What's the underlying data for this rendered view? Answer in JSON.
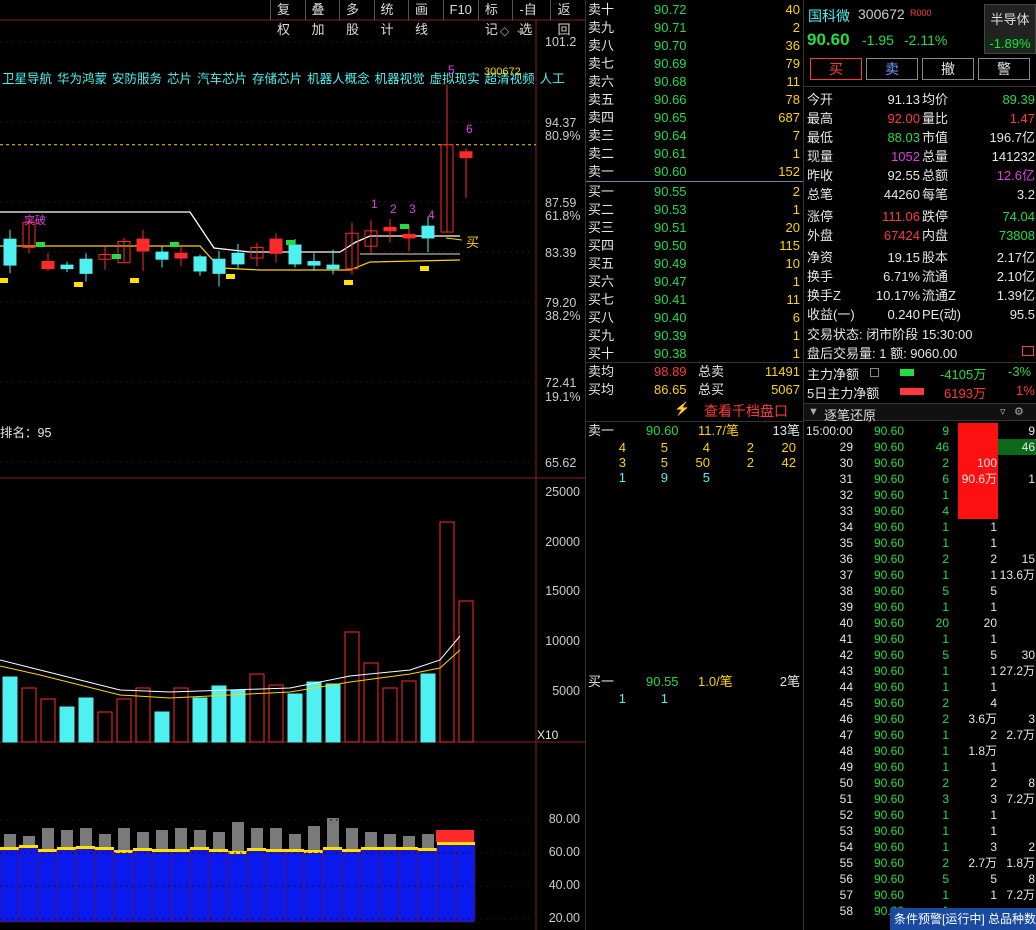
{
  "toolbar": [
    "复权",
    "叠加",
    "多股",
    "统计",
    "画线",
    "F10",
    "标记",
    "-自选",
    "返回"
  ],
  "concepts": [
    "卫星导航",
    "华为鸿蒙",
    "安防服务",
    "芯片",
    "汽车芯片",
    "存储芯片",
    "机器人概念",
    "机器视觉",
    "虚拟现实",
    "超清视频",
    "人工"
  ],
  "chart": {
    "code_label": "300672",
    "rank_label": "排名：95",
    "buy_label": "买",
    "cover_label": "突破",
    "marks": [
      "1",
      "2",
      "3",
      "4",
      "5",
      "6"
    ],
    "y_ticks": [
      "101.2",
      "94.37",
      "87.59",
      "83.39",
      "79.20",
      "72.41",
      "65.62"
    ],
    "y_pcts": [
      "80.9%",
      "61.8%",
      "38.2%",
      "19.1%"
    ],
    "vol_ticks": [
      "25000",
      "20000",
      "15000",
      "10000",
      "5000"
    ],
    "x10": "X10",
    "ind_ticks": [
      "80.00",
      "60.00",
      "40.00",
      "20.00"
    ]
  },
  "chart_data": {
    "type": "candlestick",
    "candles": [
      {
        "o": 84.5,
        "c": 82.3,
        "h": 85.3,
        "l": 81.6,
        "k": "cyan"
      },
      {
        "o": 83.8,
        "c": 85.9,
        "h": 86.3,
        "l": 83.3,
        "k": "red"
      },
      {
        "o": 82.6,
        "c": 82.0,
        "h": 83.3,
        "l": 81.8,
        "k": "red"
      },
      {
        "o": 82.3,
        "c": 82.0,
        "h": 82.6,
        "l": 81.7,
        "k": "cyan"
      },
      {
        "o": 82.8,
        "c": 81.6,
        "h": 83.3,
        "l": 80.9,
        "k": "cyan"
      },
      {
        "o": 82.8,
        "c": 83.2,
        "h": 83.9,
        "l": 81.9,
        "k": "red"
      },
      {
        "o": 82.5,
        "c": 84.3,
        "h": 84.6,
        "l": 82.5,
        "k": "red"
      },
      {
        "o": 84.5,
        "c": 83.5,
        "h": 85.3,
        "l": 81.8,
        "k": "red"
      },
      {
        "o": 82.8,
        "c": 83.4,
        "h": 83.9,
        "l": 82.1,
        "k": "cyan"
      },
      {
        "o": 83.3,
        "c": 82.9,
        "h": 83.9,
        "l": 82.2,
        "k": "red"
      },
      {
        "o": 83.0,
        "c": 81.8,
        "h": 83.2,
        "l": 81.4,
        "k": "cyan"
      },
      {
        "o": 82.8,
        "c": 81.6,
        "h": 83.5,
        "l": 80.5,
        "k": "cyan"
      },
      {
        "o": 83.3,
        "c": 82.4,
        "h": 84.1,
        "l": 82.0,
        "k": "cyan"
      },
      {
        "o": 82.9,
        "c": 83.8,
        "h": 84.2,
        "l": 82.2,
        "k": "red"
      },
      {
        "o": 84.5,
        "c": 83.3,
        "h": 85.0,
        "l": 82.5,
        "k": "red"
      },
      {
        "o": 84.0,
        "c": 82.4,
        "h": 84.5,
        "l": 82.1,
        "k": "cyan"
      },
      {
        "o": 82.6,
        "c": 82.3,
        "h": 83.3,
        "l": 81.8,
        "k": "cyan"
      },
      {
        "o": 82.3,
        "c": 82.0,
        "h": 83.6,
        "l": 81.5,
        "k": "cyan"
      },
      {
        "o": 82.0,
        "c": 85.0,
        "h": 85.9,
        "l": 81.5,
        "k": "red"
      },
      {
        "o": 83.9,
        "c": 85.2,
        "h": 86.1,
        "l": 83.3,
        "k": "red"
      },
      {
        "o": 85.5,
        "c": 85.2,
        "h": 86.2,
        "l": 84.2,
        "k": "red"
      },
      {
        "o": 84.9,
        "c": 84.6,
        "h": 85.7,
        "l": 83.5,
        "k": "red"
      },
      {
        "o": 85.6,
        "c": 84.6,
        "h": 86.4,
        "l": 83.4,
        "k": "cyan"
      },
      {
        "o": 85.1,
        "c": 92.5,
        "h": 97.6,
        "l": 85.1,
        "k": "red"
      },
      {
        "o": 91.9,
        "c": 91.4,
        "h": 92.2,
        "l": 88.0,
        "k": "red"
      }
    ],
    "volume": [
      6500,
      5400,
      4300,
      3500,
      4400,
      0,
      4300,
      5400,
      0,
      5400,
      4400,
      5600,
      5200,
      6800,
      5700,
      4800,
      6000,
      5800,
      11000,
      7900,
      5400,
      6100,
      6800,
      22000,
      14100
    ]
  },
  "orderbook": {
    "asks": [
      {
        "label": "卖十",
        "price": "90.72",
        "qty": "40"
      },
      {
        "label": "卖九",
        "price": "90.71",
        "qty": "2"
      },
      {
        "label": "卖八",
        "price": "90.70",
        "qty": "36"
      },
      {
        "label": "卖七",
        "price": "90.69",
        "qty": "79"
      },
      {
        "label": "卖六",
        "price": "90.68",
        "qty": "11"
      },
      {
        "label": "卖五",
        "price": "90.66",
        "qty": "78"
      },
      {
        "label": "卖四",
        "price": "90.65",
        "qty": "687"
      },
      {
        "label": "卖三",
        "price": "90.64",
        "qty": "7"
      },
      {
        "label": "卖二",
        "price": "90.61",
        "qty": "1"
      },
      {
        "label": "卖一",
        "price": "90.60",
        "qty": "152"
      }
    ],
    "bids": [
      {
        "label": "买一",
        "price": "90.55",
        "qty": "2"
      },
      {
        "label": "买二",
        "price": "90.53",
        "qty": "1"
      },
      {
        "label": "买三",
        "price": "90.51",
        "qty": "20"
      },
      {
        "label": "买四",
        "price": "90.50",
        "qty": "115"
      },
      {
        "label": "买五",
        "price": "90.49",
        "qty": "10"
      },
      {
        "label": "买六",
        "price": "90.47",
        "qty": "1"
      },
      {
        "label": "买七",
        "price": "90.41",
        "qty": "11"
      },
      {
        "label": "买八",
        "price": "90.40",
        "qty": "6"
      },
      {
        "label": "买九",
        "price": "90.39",
        "qty": "1"
      },
      {
        "label": "买十",
        "price": "90.38",
        "qty": "1"
      }
    ],
    "ask_avg_label": "卖均",
    "ask_avg": "98.89",
    "ask_total_label": "总卖",
    "ask_total": "11491",
    "bid_avg_label": "买均",
    "bid_avg": "86.65",
    "bid_total_label": "总买",
    "bid_total": "5067",
    "thousand_link": "查看千档盘口",
    "ask1_detail": {
      "label": "卖一",
      "price": "90.60",
      "per": "11.7/笔",
      "count": "13笔",
      "rows": [
        [
          "4",
          "5",
          "4",
          "2",
          "20"
        ],
        [
          "3",
          "5",
          "50",
          "2",
          "42"
        ],
        [
          "1",
          "9",
          "5",
          "",
          ""
        ]
      ]
    },
    "bid1_detail": {
      "label": "买一",
      "price": "90.55",
      "per": "1.0/笔",
      "count": "2笔",
      "rows": [
        [
          "1",
          "1",
          "",
          "",
          ""
        ]
      ]
    }
  },
  "info": {
    "name": "国科微",
    "code": "300672",
    "tag": "R000",
    "sector": "半导体",
    "price": "90.60",
    "change": "-1.95",
    "pct": "-2.11%",
    "sector_pct": "-1.89%",
    "buttons": [
      "买",
      "卖",
      "撤",
      "警"
    ],
    "rows": [
      [
        [
          "今开",
          "91.13",
          "white"
        ],
        [
          "均价",
          "89.39",
          "green"
        ]
      ],
      [
        [
          "最高",
          "92.00",
          "red"
        ],
        [
          "量比",
          "1.47",
          "red"
        ]
      ],
      [
        [
          "最低",
          "88.03",
          "green"
        ],
        [
          "市值",
          "196.7亿",
          "white"
        ]
      ],
      [
        [
          "现量",
          "1052",
          "magenta"
        ],
        [
          "总量",
          "141232",
          "white"
        ]
      ],
      [
        [
          "昨收",
          "92.55",
          "white"
        ],
        [
          "总额",
          "12.6亿",
          "magenta"
        ]
      ],
      [
        [
          "总笔",
          "44260",
          "white"
        ],
        [
          "每笔",
          "3.2",
          "white"
        ]
      ],
      [
        [
          "涨停",
          "111.06",
          "red"
        ],
        [
          "跌停",
          "74.04",
          "green"
        ]
      ],
      [
        [
          "外盘",
          "67424",
          "red"
        ],
        [
          "内盘",
          "73808",
          "green"
        ]
      ],
      [
        [
          "净资",
          "19.15",
          "white"
        ],
        [
          "股本",
          "2.17亿",
          "white"
        ]
      ],
      [
        [
          "换手",
          "6.71%",
          "white"
        ],
        [
          "流通",
          "2.10亿",
          "white"
        ]
      ],
      [
        [
          "换手Z",
          "10.17%",
          "white"
        ],
        [
          "流通Z",
          "1.39亿",
          "white"
        ]
      ],
      [
        [
          "收益(一)",
          "0.240",
          "white"
        ],
        [
          "PE(动)",
          "95.5",
          "white"
        ]
      ]
    ],
    "status": "交易状态: 闭市阶段 15:30:00",
    "after": "盘后交易量: 1  额: 9060.00",
    "main_flow_label": "主力净额",
    "main_flow": "-4105万",
    "main_flow_pct": "-3%",
    "flow5_label": "5日主力净额",
    "flow5": "6193万",
    "flow5_pct": "1%",
    "ticks_title": "逐笔还原",
    "ticks": [
      [
        "15:00:00",
        "90.60",
        "9",
        "",
        "9"
      ],
      [
        "29",
        "90.60",
        "46",
        "",
        "46"
      ],
      [
        "30",
        "90.60",
        "2",
        "100",
        ""
      ],
      [
        "31",
        "90.60",
        "6",
        "90.6万",
        "1"
      ],
      [
        "32",
        "90.60",
        "1",
        "",
        ""
      ],
      [
        "33",
        "90.60",
        "4",
        "",
        ""
      ],
      [
        "34",
        "90.60",
        "1",
        "1",
        ""
      ],
      [
        "35",
        "90.60",
        "1",
        "1",
        ""
      ],
      [
        "36",
        "90.60",
        "2",
        "2",
        "15"
      ],
      [
        "37",
        "90.60",
        "1",
        "1",
        "13.6万"
      ],
      [
        "38",
        "90.60",
        "5",
        "5",
        ""
      ],
      [
        "39",
        "90.60",
        "1",
        "1",
        ""
      ],
      [
        "40",
        "90.60",
        "20",
        "20",
        ""
      ],
      [
        "41",
        "90.60",
        "1",
        "1",
        ""
      ],
      [
        "42",
        "90.60",
        "5",
        "5",
        "30"
      ],
      [
        "43",
        "90.60",
        "1",
        "1",
        "27.2万"
      ],
      [
        "44",
        "90.60",
        "1",
        "1",
        ""
      ],
      [
        "45",
        "90.60",
        "2",
        "4",
        ""
      ],
      [
        "46",
        "90.60",
        "2",
        "3.6万",
        "3"
      ],
      [
        "47",
        "90.60",
        "1",
        "2",
        "2.7万"
      ],
      [
        "48",
        "90.60",
        "1",
        "1.8万",
        ""
      ],
      [
        "49",
        "90.60",
        "1",
        "1",
        ""
      ],
      [
        "50",
        "90.60",
        "2",
        "2",
        "8"
      ],
      [
        "51",
        "90.60",
        "3",
        "3",
        "7.2万"
      ],
      [
        "52",
        "90.60",
        "1",
        "1",
        ""
      ],
      [
        "53",
        "90.60",
        "1",
        "1",
        ""
      ],
      [
        "54",
        "90.60",
        "1",
        "3",
        "2"
      ],
      [
        "55",
        "90.60",
        "2",
        "2.7万",
        "1.8万"
      ],
      [
        "56",
        "90.60",
        "5",
        "5",
        "8"
      ],
      [
        "57",
        "90.60",
        "1",
        "1",
        "7.2万"
      ],
      [
        "58",
        "90.60",
        "1",
        "",
        ""
      ]
    ],
    "alert": "条件预警[运行中] 总品种数"
  }
}
